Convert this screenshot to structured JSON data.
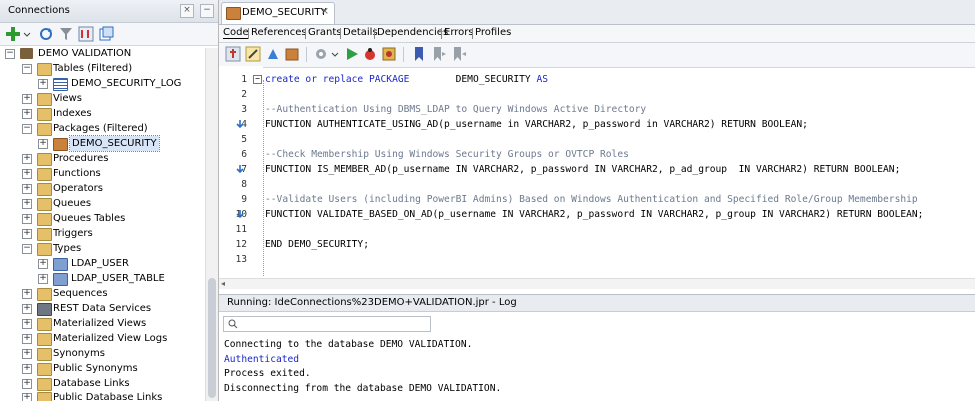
{
  "connections": {
    "title": "Connections",
    "tree": [
      {
        "label": "DEMO VALIDATION"
      },
      {
        "label": "Tables (Filtered)"
      },
      {
        "label": "DEMO_SECURITY_LOG"
      },
      {
        "label": "Views"
      },
      {
        "label": "Indexes"
      },
      {
        "label": "Packages (Filtered)"
      },
      {
        "label": "DEMO_SECURITY"
      },
      {
        "label": "Procedures"
      },
      {
        "label": "Functions"
      },
      {
        "label": "Operators"
      },
      {
        "label": "Queues"
      },
      {
        "label": "Queues Tables"
      },
      {
        "label": "Triggers"
      },
      {
        "label": "Types"
      },
      {
        "label": "LDAP_USER"
      },
      {
        "label": "LDAP_USER_TABLE"
      },
      {
        "label": "Sequences"
      },
      {
        "label": "REST Data Services"
      },
      {
        "label": "Materialized Views"
      },
      {
        "label": "Materialized View Logs"
      },
      {
        "label": "Synonyms"
      },
      {
        "label": "Public Synonyms"
      },
      {
        "label": "Database Links"
      },
      {
        "label": "Public Database Links"
      }
    ]
  },
  "editor": {
    "tab_title": "DEMO_SECURITY",
    "subtabs": [
      "Code",
      "References",
      "Grants",
      "Details",
      "Dependencies",
      "Errors",
      "Profiles"
    ],
    "line_numbers": [
      "1",
      "2",
      "3",
      "4",
      "5",
      "6",
      "7",
      "8",
      "9",
      "10",
      "11",
      "12",
      "13"
    ],
    "lines": {
      "l1a": "create or replace PACKAGE",
      "l1b": "DEMO_SECURITY",
      "l1c": "AS",
      "l3": "--Authentication Using DBMS_LDAP to Query Windows Active Directory",
      "l4": "FUNCTION AUTHENTICATE_USING_AD(p_username in VARCHAR2, p_password in VARCHAR2) RETURN BOOLEAN;",
      "l6": "--Check Membership Using Windows Security Groups or OVTCP Roles",
      "l7": "FUNCTION IS_MEMBER_AD(p_username IN VARCHAR2, p_password IN VARCHAR2, p_ad_group  IN VARCHAR2) RETURN BOOLEAN;",
      "l9": "--Validate Users (including PowerBI Admins) Based on Windows Authentication and Specified Role/Group Memembership",
      "l10": "FUNCTION VALIDATE_BASED_ON_AD(p_username IN VARCHAR2, p_password IN VARCHAR2, p_group IN VARCHAR2) RETURN BOOLEAN;",
      "l12": "END DEMO_SECURITY;"
    }
  },
  "log": {
    "header": "Running: IdeConnections%23DEMO+VALIDATION.jpr - Log",
    "lines": [
      "Connecting to the database DEMO VALIDATION.",
      "Authenticated",
      "Process exited.",
      "Disconnecting from the database DEMO VALIDATION."
    ]
  },
  "colors": {
    "keyword": "#1b28c7",
    "comment": "#6c7a8e",
    "selection": "#d7e5f7"
  }
}
